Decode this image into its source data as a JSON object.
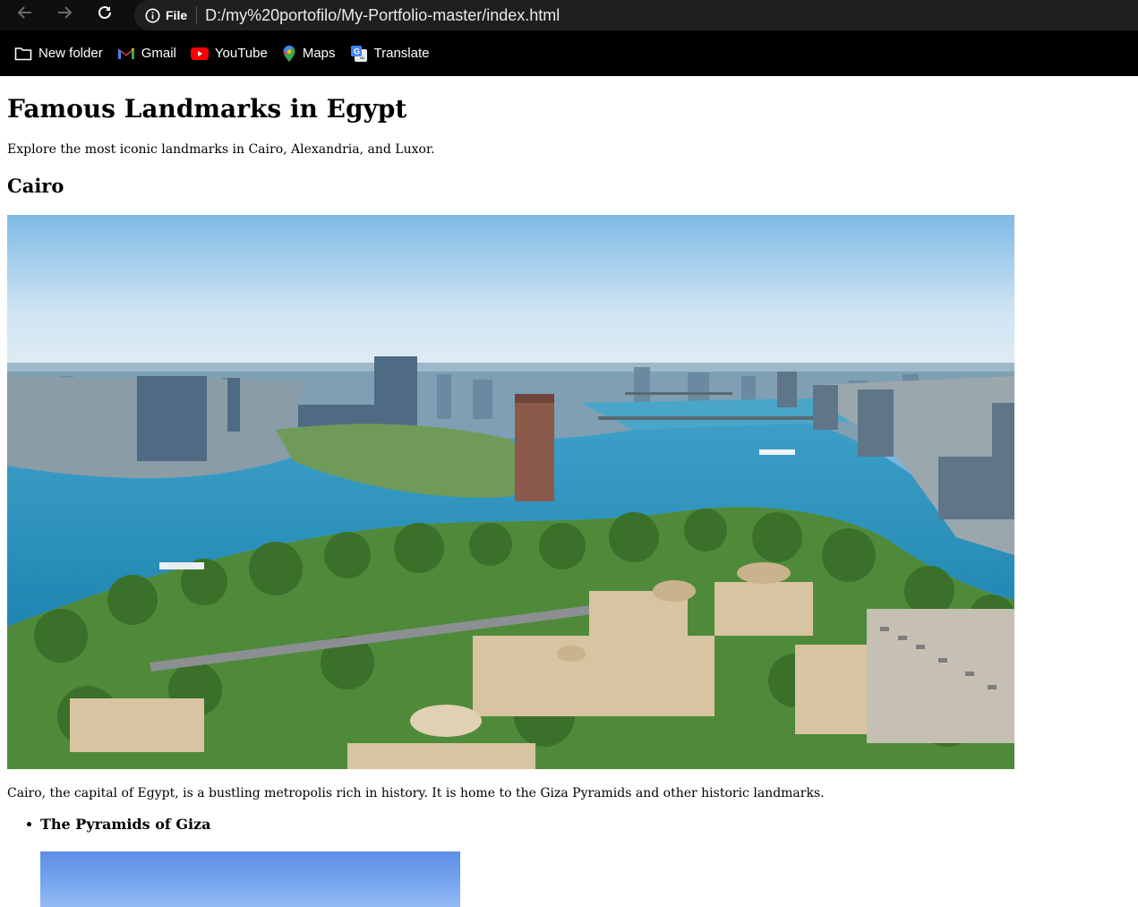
{
  "browser": {
    "site_info_label": "File",
    "url": "D:/my%20portofilo/My-Portfolio-master/index.html",
    "bookmarks": [
      {
        "label": "New folder",
        "icon": "folder-icon"
      },
      {
        "label": "Gmail",
        "icon": "gmail-icon"
      },
      {
        "label": "YouTube",
        "icon": "youtube-icon"
      },
      {
        "label": "Maps",
        "icon": "maps-icon"
      },
      {
        "label": "Translate",
        "icon": "translate-icon"
      }
    ]
  },
  "page": {
    "title": "Famous Landmarks in Egypt",
    "intro": "Explore the most iconic landmarks in Cairo, Alexandria, and Luxor.",
    "sections": [
      {
        "heading": "Cairo",
        "description": "Cairo, the capital of Egypt, is a bustling metropolis rich in history. It is home to the Giza Pyramids and other historic landmarks.",
        "landmarks": [
          {
            "name": "The Pyramids of Giza"
          }
        ]
      }
    ]
  },
  "colors": {
    "chrome_bg": "#0f0f0f",
    "omnibox_bg": "#1f1f1f",
    "bookmark_bar_bg": "#000000",
    "nile_blue": "#2e8fb4",
    "sky_blue": "#8fc4ea"
  }
}
